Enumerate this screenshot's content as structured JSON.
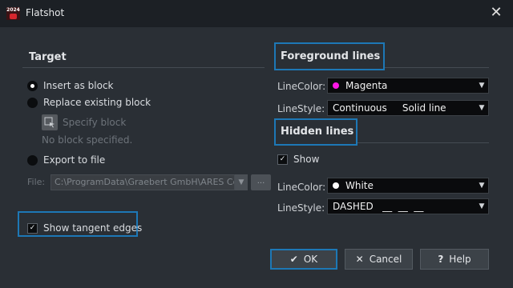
{
  "window": {
    "title": "Flatshot",
    "app_icon_year": "2024",
    "close_glyph": "✕"
  },
  "target": {
    "title": "Target",
    "options": [
      {
        "label": "Insert as block",
        "selected": true
      },
      {
        "label": "Replace existing block",
        "selected": false
      },
      {
        "label": "Export to file",
        "selected": false
      }
    ],
    "specify_block_label": "Specify block",
    "no_block_label": "No block specified.",
    "file_label": "File:",
    "file_path": "C:\\ProgramData\\Graebert GmbH\\ARES Cor",
    "browse_label": "...",
    "show_tangent_label": "Show tangent edges",
    "show_tangent_checked": true
  },
  "foreground": {
    "title": "Foreground lines",
    "line_color_label": "LineColor:",
    "line_color_value": "Magenta",
    "line_color_swatch": "#ff17e6",
    "line_style_label": "LineStyle:",
    "line_style_value": "Continuous     Solid line"
  },
  "hidden": {
    "title": "Hidden lines",
    "show_label": "Show",
    "show_checked": true,
    "line_color_label": "LineColor:",
    "line_color_value": "White",
    "line_color_swatch": "#ffffff",
    "line_style_label": "LineStyle:",
    "line_style_value": "DASHED   __  __  __"
  },
  "footer": {
    "ok_icon": "✔",
    "ok_label": "OK",
    "cancel_icon": "✕",
    "cancel_label": "Cancel",
    "help_icon": "?",
    "help_label": "Help"
  },
  "colors": {
    "accent": "#1d78b6",
    "background": "#2a2f35",
    "titlebar": "#1c2025"
  }
}
